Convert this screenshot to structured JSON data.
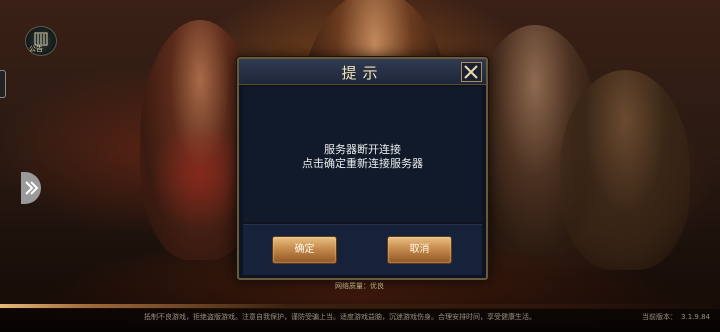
{
  "dialog": {
    "title": "提示",
    "message_line1": "服务器断开连接",
    "message_line2": "点击确定重新连接服务器",
    "confirm_label": "确定",
    "cancel_label": "取消"
  },
  "sidebar": {
    "notice_label": "公告"
  },
  "status": {
    "network": "网络质量：优良",
    "version_label": "当前版本：",
    "version_value": "3.1.9.84"
  },
  "footer": {
    "health_notice": "抵制不良游戏，拒绝盗版游戏。注意自我保护，谨防受骗上当。适度游戏益脑，沉迷游戏伤身。合理安排时间，享受健康生活。"
  },
  "colors": {
    "dialog_bg": "#0d1320",
    "frame": "#6b5838",
    "button": "#c58a4c",
    "title_text": "#f0e0b8"
  }
}
